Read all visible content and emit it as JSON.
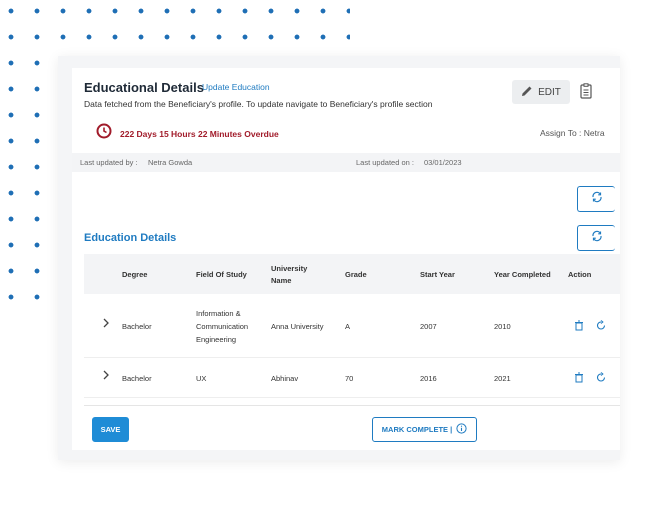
{
  "header": {
    "title": "Educational Details",
    "update_link": "Update Education",
    "subtitle": "Data fetched from the Beneficiary's profile. To update navigate to Beneficiary's profile section",
    "edit_label": "EDIT"
  },
  "status": {
    "overdue_text": "222 Days 15 Hours 22 Minutes Overdue",
    "assign_to": "Assign To : Netra"
  },
  "updated": {
    "by_label": "Last updated by :",
    "by_value": "Netra Gowda",
    "on_label": "Last updated on :",
    "on_value": "03/01/2023"
  },
  "section": {
    "title": "Education Details"
  },
  "table": {
    "headers": {
      "degree": "Degree",
      "field": "Field Of Study",
      "university_line1": "University",
      "university_line2": "Name",
      "grade": "Grade",
      "start": "Start Year",
      "completed": "Year Completed",
      "action": "Action"
    },
    "rows": [
      {
        "degree": "Bachelor",
        "field_line1": "Information &",
        "field_line2": "Communication",
        "field_line3": "Engineering",
        "university": "Anna University",
        "grade": "A",
        "start": "2007",
        "completed": "2010"
      },
      {
        "degree": "Bachelor",
        "field": "UX",
        "university": "Abhinav",
        "grade": "70",
        "start": "2016",
        "completed": "2021"
      }
    ]
  },
  "footer": {
    "save_label": "SAVE",
    "mark_complete_label": "MARK COMPLETE |"
  },
  "colors": {
    "accent": "#1f7bc1",
    "overdue": "#a11b2a",
    "dots": "#1f6fb5"
  }
}
